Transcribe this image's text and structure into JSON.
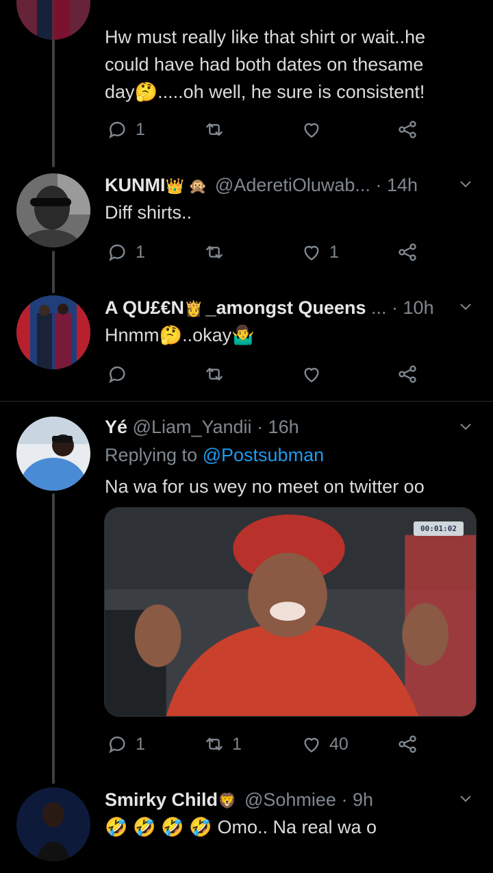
{
  "tweets": [
    {
      "text_lines": [
        "Hw must really like that shirt or wait..he",
        "could have had both dates on thesame",
        "day🤔.....oh well, he sure is consistent!"
      ],
      "reply_count": "1",
      "retweet_count": "",
      "like_count": ""
    },
    {
      "name": "KUNMI",
      "name_badges": "👑 🙊",
      "handle": "@AderetiOluwab...",
      "time": "· 14h",
      "text": "Diff shirts..",
      "reply_count": "1",
      "retweet_count": "",
      "like_count": "1"
    },
    {
      "name": "A QU£€N",
      "name_badge": "👸",
      "name_suffix": "_amongst Queens",
      "handle": "...",
      "time": "· 10h",
      "text": "Hnmm🤔..okay🤷‍♂️",
      "reply_count": "",
      "retweet_count": "",
      "like_count": ""
    },
    {
      "name": "Yé",
      "handle": "@Liam_Yandii",
      "time": "· 16h",
      "replying_prefix": "Replying to",
      "replying_handle": "@Postsubman",
      "text": "Na wa for us wey no meet on twitter oo",
      "media_timestamp": "00:01:02",
      "reply_count": "1",
      "retweet_count": "1",
      "like_count": "40"
    },
    {
      "name": "Smirky Child",
      "name_badge": "🦁",
      "handle": "@Sohmiee",
      "time": "· 9h",
      "text": "🤣 🤣 🤣 🤣 Omo.. Na real wa o"
    }
  ],
  "colors": {
    "background": "#000000",
    "text": "#dcdcdc",
    "muted": "#808890",
    "link": "#1d9bf0",
    "thread_line": "#3d4145"
  },
  "icons": [
    "reply-icon",
    "retweet-icon",
    "like-icon",
    "share-icon",
    "chevron-down-icon"
  ]
}
